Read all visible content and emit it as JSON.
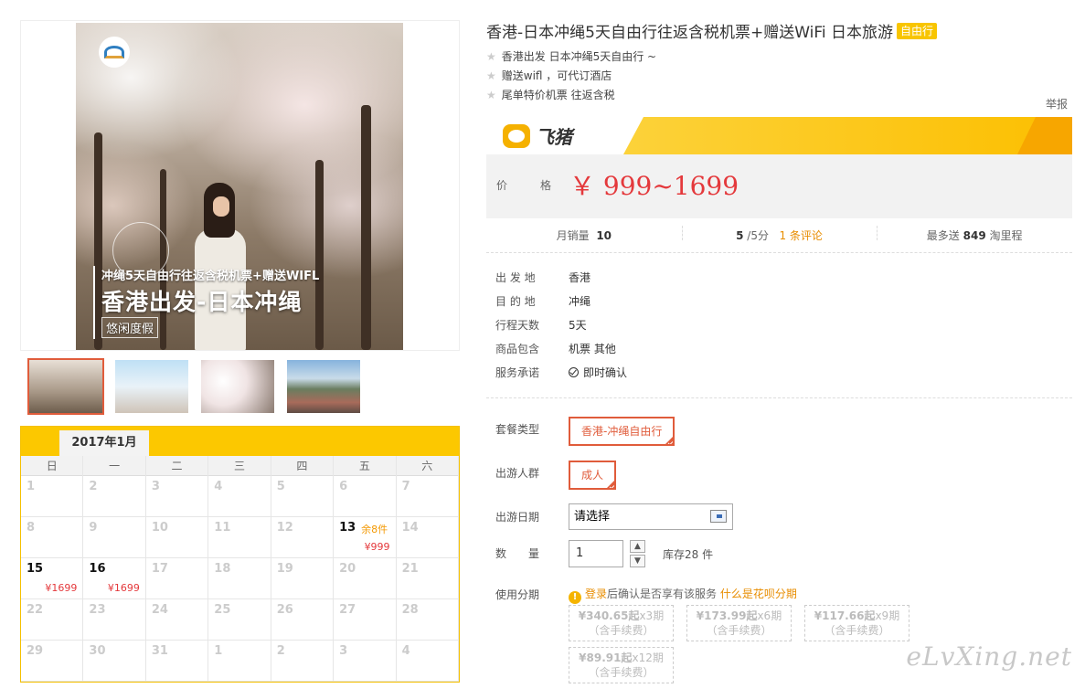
{
  "gallery": {
    "overlay_line1": "冲绳5天自由行往返含税机票+赠送WIFL",
    "overlay_line2": "香港出发-日本冲绳",
    "overlay_tag": "悠闲度假"
  },
  "calendar": {
    "month": "2017年1月",
    "weekdays": [
      "日",
      "一",
      "二",
      "三",
      "四",
      "五",
      "六"
    ],
    "rows": [
      [
        {
          "d": "1"
        },
        {
          "d": "2"
        },
        {
          "d": "3"
        },
        {
          "d": "4"
        },
        {
          "d": "5"
        },
        {
          "d": "6"
        },
        {
          "d": "7"
        }
      ],
      [
        {
          "d": "8"
        },
        {
          "d": "9"
        },
        {
          "d": "10"
        },
        {
          "d": "11"
        },
        {
          "d": "12"
        },
        {
          "d": "13",
          "stock": "余8件",
          "price": "¥999"
        },
        {
          "d": "14"
        }
      ],
      [
        {
          "d": "15",
          "price": "¥1699"
        },
        {
          "d": "16",
          "price": "¥1699"
        },
        {
          "d": "17"
        },
        {
          "d": "18"
        },
        {
          "d": "19"
        },
        {
          "d": "20"
        },
        {
          "d": "21"
        }
      ],
      [
        {
          "d": "22"
        },
        {
          "d": "23"
        },
        {
          "d": "24"
        },
        {
          "d": "25"
        },
        {
          "d": "26"
        },
        {
          "d": "27"
        },
        {
          "d": "28"
        }
      ],
      [
        {
          "d": "29"
        },
        {
          "d": "30"
        },
        {
          "d": "31"
        },
        {
          "d": "1"
        },
        {
          "d": "2"
        },
        {
          "d": "3"
        },
        {
          "d": "4"
        }
      ]
    ]
  },
  "product": {
    "title": "香港-日本冲绳5天自由行往返含税机票+赠送WiFi 日本旅游",
    "tag": "自由行",
    "features": [
      "香港出发 日本冲绳5天自由行 ~",
      "赠送wifl ，可代订酒店",
      "尾单特价机票 往返含税"
    ],
    "report": "举报"
  },
  "price_box": {
    "brand": "飞猪",
    "label": "价　　格",
    "value": "￥ 999~1699"
  },
  "stats": {
    "monthly_label": "月销量",
    "monthly_value": "10",
    "score_value": "5",
    "score_suffix": "/5分",
    "reviews": "1 条评论",
    "points_prefix": "最多送",
    "points_value": "849",
    "points_suffix": "淘里程"
  },
  "info": [
    {
      "label": "出 发 地",
      "value": "香港"
    },
    {
      "label": "目 的 地",
      "value": "冲绳"
    },
    {
      "label": "行程天数",
      "value": "5天"
    },
    {
      "label": "商品包含",
      "value": "机票  其他"
    },
    {
      "label": "服务承诺",
      "value": "即时确认"
    }
  ],
  "options": {
    "package_label": "套餐类型",
    "package_value": "香港-冲绳自由行",
    "crowd_label": "出游人群",
    "crowd_value": "成人",
    "date_label": "出游日期",
    "date_placeholder": "请选择",
    "qty_label": "数　　量",
    "qty_value": "1",
    "stock": "库存28 件",
    "installment_label": "使用分期",
    "login": "登录",
    "login_note": "后确认是否享有该服务",
    "huabei_link": "什么是花呗分期",
    "plans": [
      {
        "amount": "¥340.65起",
        "period": "x3期",
        "fee": "（含手续费）"
      },
      {
        "amount": "¥173.99起",
        "period": "x6期",
        "fee": "（含手续费）"
      },
      {
        "amount": "¥117.66起",
        "period": "x9期",
        "fee": "（含手续费）"
      },
      {
        "amount": "¥89.91起",
        "period": "x12期",
        "fee": "（含手续费）"
      }
    ]
  },
  "watermark": "eLvXing.net"
}
